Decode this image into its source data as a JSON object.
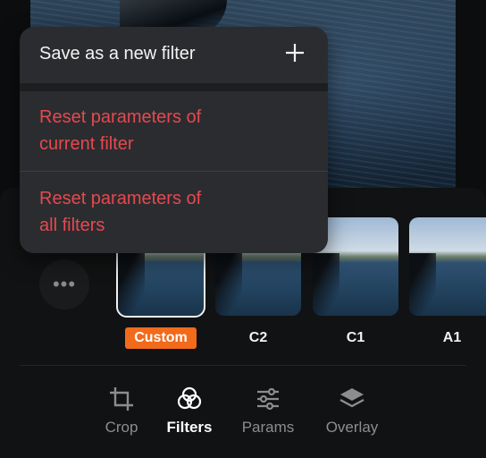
{
  "menu": {
    "save_new_filter": "Save as a new filter",
    "reset_current": [
      "Reset parameters of",
      "current filter"
    ],
    "reset_all": [
      "Reset parameters of",
      "all filters"
    ],
    "plus_icon": "plus-icon"
  },
  "more_button": {
    "label": "•••",
    "icon": "more-icon"
  },
  "filters": [
    {
      "label": "Custom",
      "selected": true
    },
    {
      "label": "C2",
      "selected": false
    },
    {
      "label": "C1",
      "selected": false
    },
    {
      "label": "A1",
      "selected": false
    }
  ],
  "tabs": [
    {
      "label": "Crop",
      "icon": "crop-icon",
      "active": false
    },
    {
      "label": "Filters",
      "icon": "filters-icon",
      "active": true
    },
    {
      "label": "Params",
      "icon": "sliders-icon",
      "active": false
    },
    {
      "label": "Overlay",
      "icon": "layers-icon",
      "active": false
    }
  ],
  "colors": {
    "accent": "#f26a1b",
    "destructive": "#e5494f",
    "menu_bg": "#2b2c2f"
  }
}
